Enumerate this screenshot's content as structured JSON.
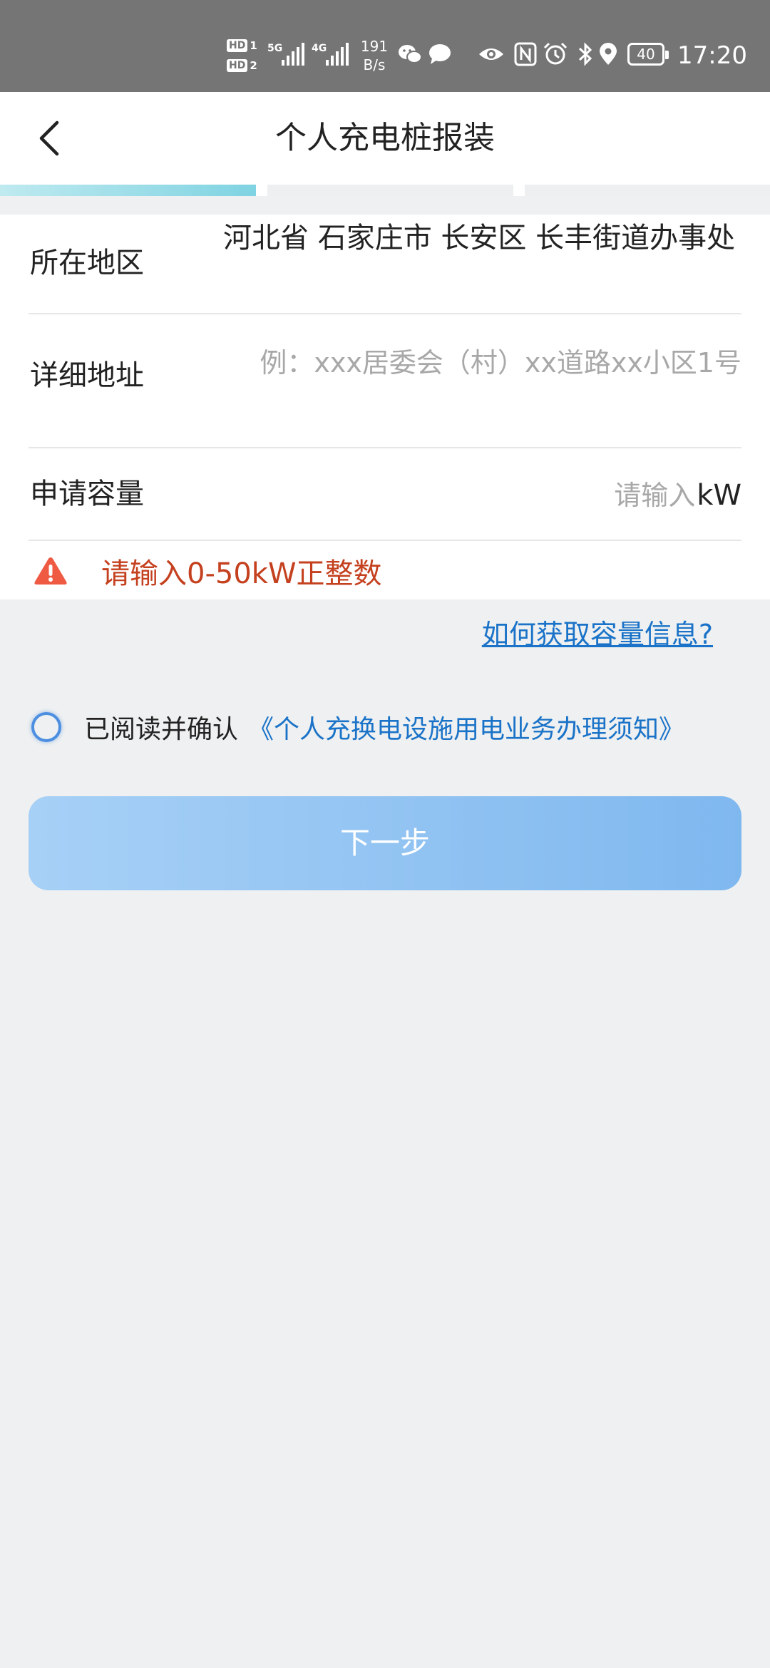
{
  "status_bar": {
    "hd1": "HD",
    "hd1_sim": "1",
    "hd2": "HD",
    "hd2_sim": "2",
    "net1": "5G",
    "net2": "4G",
    "rate_value": "191",
    "rate_unit": "B/s",
    "battery": "40",
    "time": "17:20",
    "icons": [
      "wechat-icon",
      "message-icon",
      "eye-icon",
      "nfc-icon",
      "alarm-icon",
      "bluetooth-icon",
      "location-icon"
    ]
  },
  "header": {
    "title": "个人充电桩报装",
    "back_icon": "chevron-left-icon"
  },
  "steps": {
    "total": 3,
    "current": 1
  },
  "form": {
    "region": {
      "label": "所在地区",
      "value": "河北省 石家庄市 长安区 长丰街道办事处"
    },
    "address": {
      "label": "详细地址",
      "value": "",
      "placeholder": "例：xxx居委会（村）xx道路xx小区1号"
    },
    "capacity": {
      "label": "申请容量",
      "value": "",
      "placeholder": "请输入",
      "unit": "kW"
    },
    "error": {
      "icon": "warning-triangle-icon",
      "text": "请输入0-50kW正整数",
      "color": "#c4401e"
    }
  },
  "help_link": "如何获取容量信息?",
  "agreement": {
    "checked": false,
    "text": "已阅读并确认",
    "link": "《个人充换电设施用电业务办理须知》"
  },
  "next_button": {
    "label": "下一步",
    "enabled": false
  },
  "colors": {
    "accent": "#1a73c8",
    "step_active": "#7fd3e2",
    "button": "#7fb8ef"
  }
}
